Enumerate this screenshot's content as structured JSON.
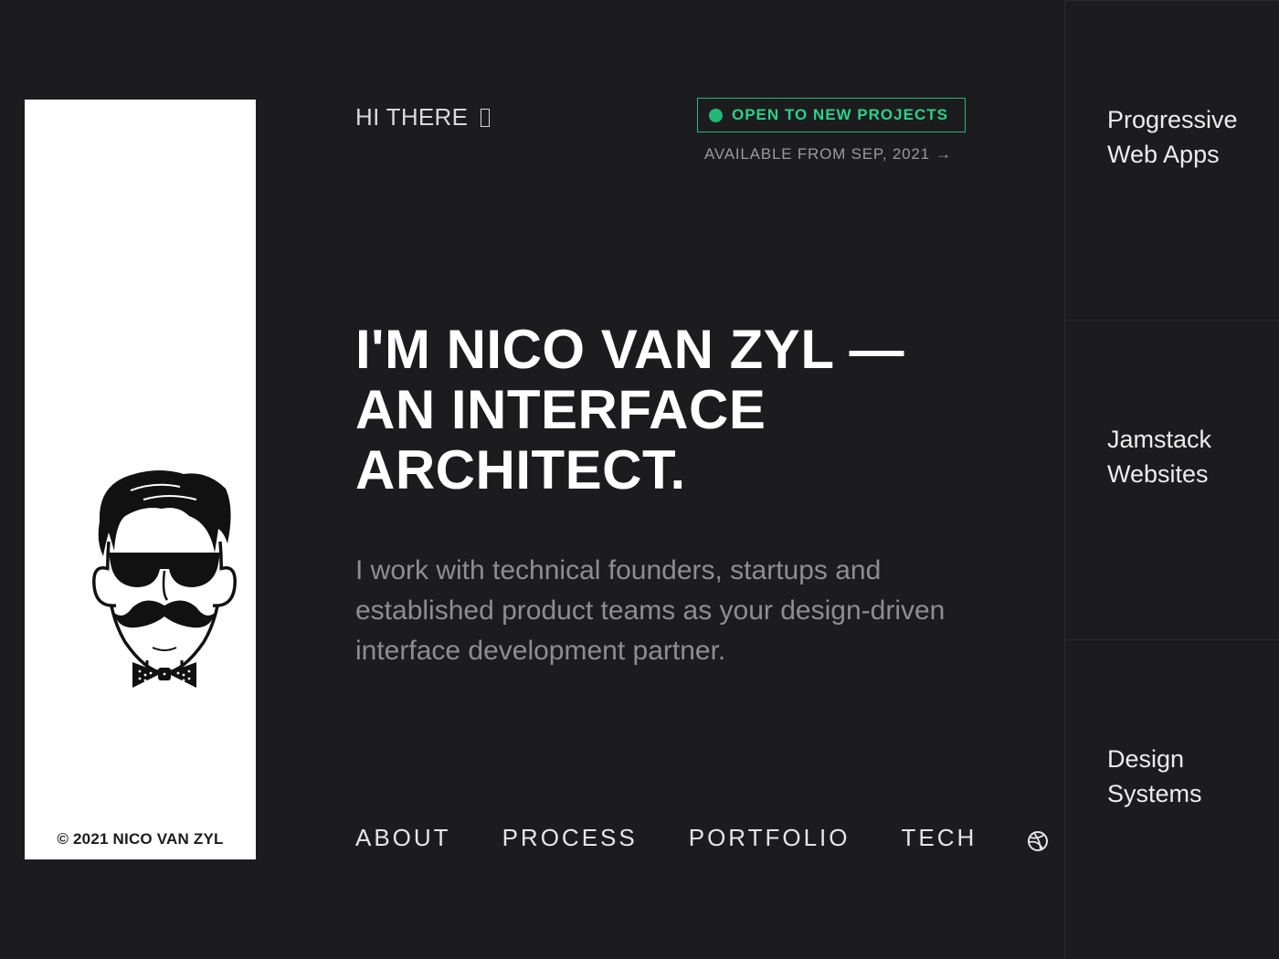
{
  "colors": {
    "background": "#1c1c1e",
    "card": "#ffffff",
    "accent_green": "#23b877",
    "muted_text": "#8e8e90"
  },
  "card": {
    "copyright": "© 2021 NICO VAN ZYL",
    "avatar_icon": "mustache-man-avatar"
  },
  "header": {
    "greeting": "HI THERE",
    "greeting_icon": "wave-hand-icon",
    "status_badge": "OPEN TO NEW PROJECTS",
    "availability": "AVAILABLE FROM SEP, 2021",
    "availability_arrow": "→"
  },
  "hero": {
    "title_lines": [
      "I'M NICO VAN ZYL —",
      "AN INTERFACE",
      "ARCHITECT."
    ],
    "subtitle": "I work with technical founders, startups and established product teams as your design-driven interface development partner."
  },
  "nav": {
    "items": [
      {
        "label": "ABOUT"
      },
      {
        "label": "PROCESS"
      },
      {
        "label": "PORTFOLIO"
      },
      {
        "label": "TECH"
      }
    ],
    "social_icon": "dribbble-icon"
  },
  "services": {
    "items": [
      {
        "label": "Progressive Web Apps"
      },
      {
        "label": "Jamstack Websites"
      },
      {
        "label": "Design Systems"
      }
    ]
  }
}
